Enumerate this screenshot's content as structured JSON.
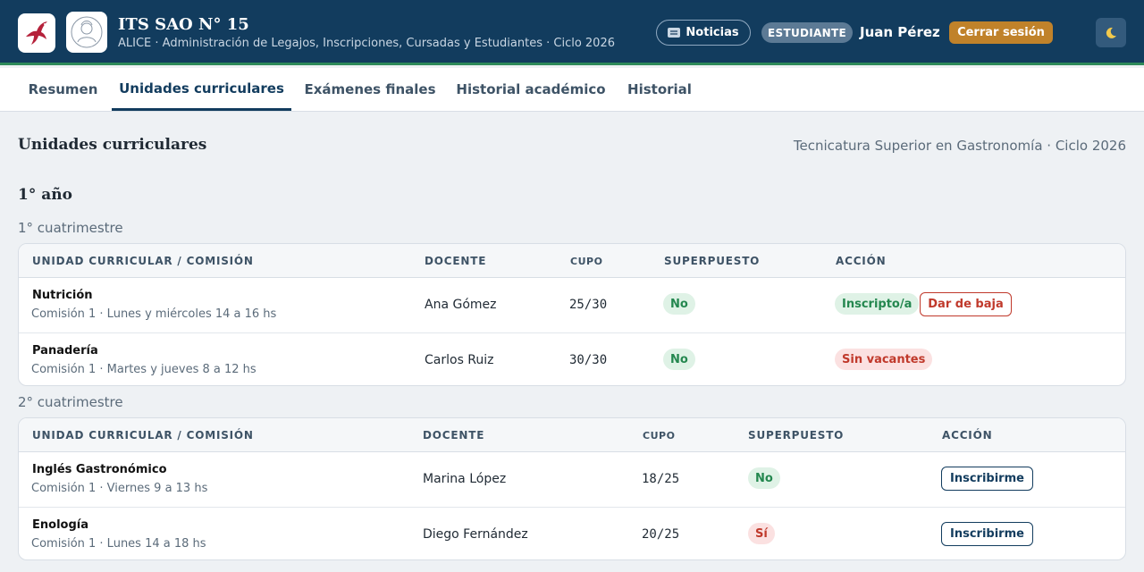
{
  "header": {
    "title": "ITS SAO N° 15",
    "subtitle": "ALICE · Administración de Legajos, Inscripciones, Cursadas y Estudiantes · Ciclo 2026",
    "logo_icon": "bird-logo-icon",
    "avatar_icon": "institution-seal-icon",
    "news_label": "Noticias",
    "news_icon": "newspaper-icon",
    "role_badge": "ESTUDIANTE",
    "user_name": "Juan Pérez",
    "logout_label": "Cerrar sesión",
    "theme_icon": "moon-icon"
  },
  "tabs": [
    {
      "label": "Resumen",
      "active": false
    },
    {
      "label": "Unidades curriculares",
      "active": true
    },
    {
      "label": "Exámenes finales",
      "active": false
    },
    {
      "label": "Historial académico",
      "active": false
    },
    {
      "label": "Historial",
      "active": false
    }
  ],
  "main": {
    "title": "Unidades curriculares",
    "career": "Tecnicatura Superior en Gastronomía · Ciclo 2026",
    "year_title": "1° año",
    "columns": {
      "subject": "UNIDAD CURRICULAR / COMISIÓN",
      "teacher": "DOCENTE",
      "quota": "CUPO",
      "overlap": "SUPERPUESTO",
      "action": "ACCIÓN"
    },
    "terms": [
      {
        "title": "1° cuatrimestre",
        "rows": [
          {
            "name": "Nutrición",
            "detail": "Comisión 1 · Lunes y miércoles 14 a 16 hs",
            "teacher": "Ana Gómez",
            "quota": "25/30",
            "overlap": "No",
            "status": "Inscripto/a",
            "action": "Dar de baja"
          },
          {
            "name": "Panadería",
            "detail": "Comisión 1 · Martes y jueves 8 a 12 hs",
            "teacher": "Carlos Ruiz",
            "quota": "30/30",
            "overlap": "No",
            "status": "Sin vacantes"
          }
        ]
      },
      {
        "title": "2° cuatrimestre",
        "rows": [
          {
            "name": "Inglés Gastronómico",
            "detail": "Comisión 1 · Viernes 9 a 13 hs",
            "teacher": "Marina López",
            "quota": "18/25",
            "overlap": "No",
            "action": "Inscribirme"
          },
          {
            "name": "Enología",
            "detail": "Comisión 1 · Lunes 14 a 18 hs",
            "teacher": "Diego Fernández",
            "quota": "20/25",
            "overlap": "Sí",
            "action": "Inscribirme"
          }
        ]
      }
    ]
  },
  "colors": {
    "header_bg": "#123c5e",
    "accent_green": "#2e8a5a",
    "logout_bg": "#c0822a",
    "success": "#24874f",
    "danger": "#c0392b"
  }
}
